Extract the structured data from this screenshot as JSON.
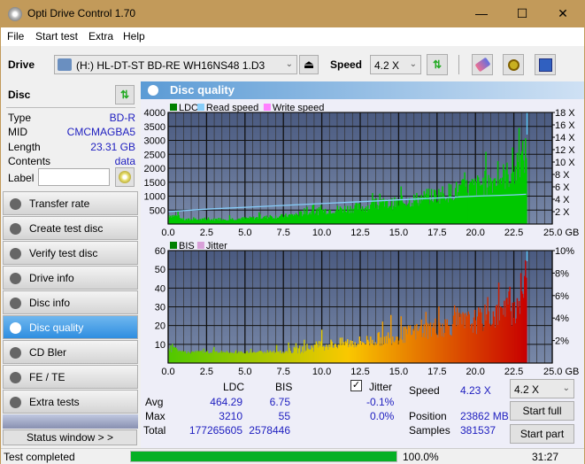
{
  "window": {
    "title": "Opti Drive Control 1.70",
    "min": "—",
    "max": "☐",
    "close": "✕"
  },
  "menu": [
    "File",
    "Start test",
    "Extra",
    "Help"
  ],
  "toolbar": {
    "drive_label": "Drive",
    "drive_value": "(H:)  HL-DT-ST BD-RE  WH16NS48 1.D3",
    "speed_label": "Speed",
    "speed_value": "4.2 X"
  },
  "disc": {
    "header": "Disc",
    "rows": [
      {
        "k": "Type",
        "v": "BD-R"
      },
      {
        "k": "MID",
        "v": "CMCMAGBA5"
      },
      {
        "k": "Length",
        "v": "23.31 GB"
      },
      {
        "k": "Contents",
        "v": "data"
      }
    ],
    "label_key": "Label",
    "label_value": ""
  },
  "nav": [
    "Transfer rate",
    "Create test disc",
    "Verify test disc",
    "Drive info",
    "Disc info",
    "Disc quality",
    "CD Bler",
    "FE / TE",
    "Extra tests"
  ],
  "nav_active": "Disc quality",
  "status_window": "Status window > >",
  "panel_title": "Disc quality",
  "chart_data": [
    {
      "type": "bar",
      "title": "LDC",
      "legend": [
        "LDC",
        "Read speed",
        "Write speed"
      ],
      "legend_colors": [
        "#008000",
        "#87cefa",
        "#ff80ff"
      ],
      "xlim": [
        0,
        25
      ],
      "x_ticks": [
        "0.0",
        "2.5",
        "5.0",
        "7.5",
        "10.0",
        "12.5",
        "15.0",
        "17.5",
        "20.0",
        "22.5",
        "25.0 GB"
      ],
      "ylim": [
        0,
        4000
      ],
      "y_ticks": [
        "4000",
        "3500",
        "3000",
        "2500",
        "2000",
        "1500",
        "1000",
        "500"
      ],
      "y2lim": [
        0,
        18
      ],
      "y2_ticks": [
        "18 X",
        "16 X",
        "14 X",
        "12 X",
        "10 X",
        "8 X",
        "6 X",
        "4 X",
        "2 X"
      ],
      "ldc_envelope": {
        "x": [
          0,
          0.5,
          1,
          2.5,
          5,
          7.5,
          10,
          12.5,
          15,
          17.5,
          20,
          22.5,
          23.3
        ],
        "y": [
          400,
          350,
          200,
          200,
          250,
          350,
          600,
          750,
          950,
          1300,
          1700,
          2300,
          3210
        ]
      },
      "read_speed": {
        "x": [
          0,
          2.5,
          5,
          7.5,
          10,
          12.5,
          15,
          17.5,
          20,
          22.5,
          23.3
        ],
        "y": [
          2.0,
          2.4,
          2.7,
          3.0,
          3.3,
          3.6,
          3.9,
          4.2,
          4.5,
          4.7,
          4.8
        ]
      },
      "grid": true
    },
    {
      "type": "bar",
      "title": "BIS",
      "legend": [
        "BIS",
        "Jitter"
      ],
      "legend_colors": [
        "#008000",
        "#d8a0d8"
      ],
      "xlim": [
        0,
        25
      ],
      "x_ticks": [
        "0.0",
        "2.5",
        "5.0",
        "7.5",
        "10.0",
        "12.5",
        "15.0",
        "17.5",
        "20.0",
        "22.5",
        "25.0 GB"
      ],
      "ylim": [
        0,
        60
      ],
      "y_ticks": [
        "60",
        "50",
        "40",
        "30",
        "20",
        "10"
      ],
      "y2lim": [
        0,
        10
      ],
      "y2_ticks": [
        "10%",
        "8%",
        "6%",
        "4%",
        "2%"
      ],
      "bis_envelope": {
        "x": [
          0,
          0.5,
          1,
          2.5,
          5,
          7.5,
          10,
          12.5,
          15,
          17.5,
          20,
          22.5,
          23.3
        ],
        "y": [
          10,
          8,
          6,
          6,
          6,
          7,
          12,
          14,
          18,
          24,
          28,
          36,
          55
        ]
      },
      "grid": true
    }
  ],
  "stats": {
    "col_ldc": "LDC",
    "col_bis": "BIS",
    "rows": [
      {
        "k": "Avg",
        "ldc": "464.29",
        "bis": "6.75"
      },
      {
        "k": "Max",
        "ldc": "3210",
        "bis": "55"
      },
      {
        "k": "Total",
        "ldc": "177265605",
        "bis": "2578446"
      }
    ],
    "jitter_label": "Jitter",
    "jitter_checked": true,
    "jitter_avg": "-0.1%",
    "jitter_max": "0.0%",
    "speed_label": "Speed",
    "speed_value": "4.23 X",
    "position_label": "Position",
    "position_value": "23862 MB",
    "samples_label": "Samples",
    "samples_value": "381537",
    "speed_select": "4.2 X",
    "start_full": "Start full",
    "start_part": "Start part"
  },
  "status": {
    "text": "Test completed",
    "progress": 100.0,
    "progress_text": "100.0%",
    "time": "31:27"
  }
}
